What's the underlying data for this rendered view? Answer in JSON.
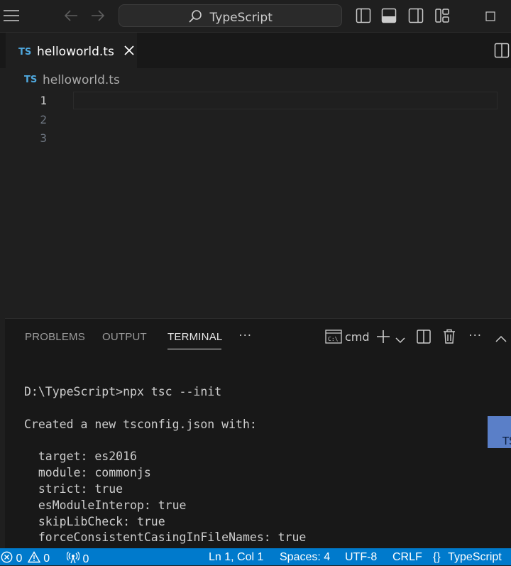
{
  "titlebar": {
    "search_label": "TypeScript"
  },
  "tab": {
    "badge": "TS",
    "label": "helloworld.ts"
  },
  "breadcrumb": {
    "badge": "TS",
    "label": "helloworld.ts"
  },
  "editor": {
    "line_numbers": [
      "1",
      "2",
      "3"
    ]
  },
  "panel": {
    "tabs": [
      "PROBLEMS",
      "OUTPUT",
      "TERMINAL"
    ],
    "active_tab": "TERMINAL",
    "more": "···",
    "shell_label": "cmd"
  },
  "terminal": {
    "lines": [
      "D:\\TypeScript>npx tsc --init",
      "Created a new tsconfig.json with:",
      "  target: es2016",
      "  module: commonjs",
      "  strict: true",
      "  esModuleInterop: true",
      "  skipLibCheck: true",
      "  forceConsistentCasingInFileNames: true"
    ]
  },
  "floating_widget": {
    "label": "TS"
  },
  "statusbar": {
    "errors": "0",
    "warnings": "0",
    "ports": "0",
    "position": "Ln 1, Col 1",
    "spaces": "Spaces: 4",
    "encoding": "UTF-8",
    "eol": "CRLF",
    "language_braces": "{}",
    "language": "TypeScript"
  },
  "colors": {
    "statusbar": "#007acc",
    "accent": "#4fa8de",
    "background": "#1f1f1f"
  }
}
